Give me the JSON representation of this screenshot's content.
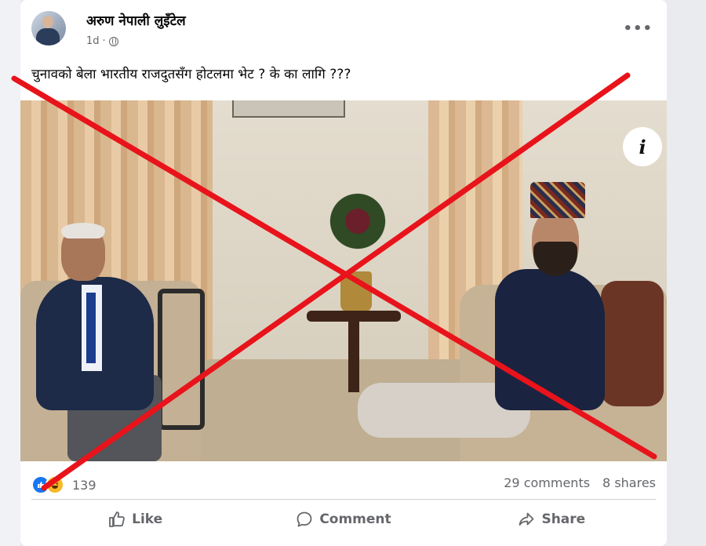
{
  "post": {
    "author": "अरुण नेपाली लुइँटेल",
    "time": "1d",
    "separator": "·",
    "text": "चुनावको बेला भारतीय राजदुतसँग होटलमा भेट ? के का लागि ???",
    "more_label": "•••",
    "info_label": "i"
  },
  "stats": {
    "reaction_count": "139",
    "comments": "29 comments",
    "shares": "8 shares"
  },
  "actions": {
    "like": "Like",
    "comment": "Comment",
    "share": "Share"
  },
  "colors": {
    "cross": "#e8131b",
    "like_blue": "#1877f2",
    "haha_yellow": "#f7b928"
  },
  "icons": [
    "globe-icon",
    "more-icon",
    "info-icon",
    "like-reaction-icon",
    "haha-reaction-icon",
    "thumbs-up-icon",
    "comment-icon",
    "share-icon"
  ]
}
